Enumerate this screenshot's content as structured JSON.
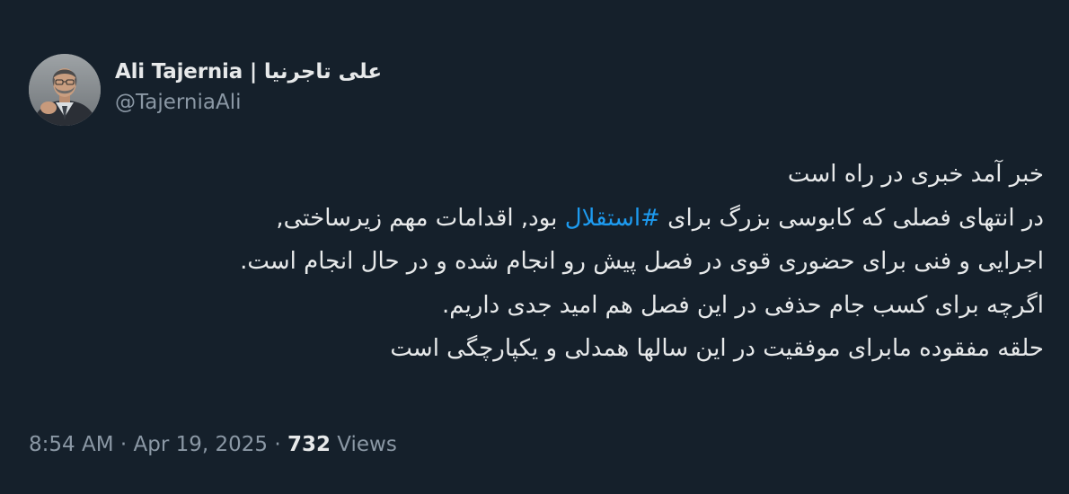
{
  "author": {
    "display_name": "Ali Tajernia | علی تاجرنیا",
    "handle": "@TajerniaAli"
  },
  "tweet": {
    "line1": "خبر آمد خبری در راه است",
    "line2_before": "در انتهای فصلی که کابوسی بزرگ برای ",
    "hashtag": "#استقلال",
    "line2_after": " بود, اقدامات مهم زیرساختی,",
    "line3": "اجرایی و فنی برای حضوری قوی در فصل پیش رو انجام شده و در حال انجام است.",
    "line4": "اگرچه برای کسب جام حذفی در این فصل هم امید جدی داریم.",
    "line5": "حلقه مفقوده مابرای موفقیت در این سالها همدلی و یکپارچگی است"
  },
  "meta": {
    "time": "8:54 AM",
    "separator": "·",
    "date": "Apr 19, 2025",
    "views_count": "732",
    "views_label": "Views"
  },
  "colors": {
    "background": "#15202b",
    "text": "#e7e9ea",
    "secondary": "#8b98a5",
    "hashtag": "#1d9bf0"
  }
}
